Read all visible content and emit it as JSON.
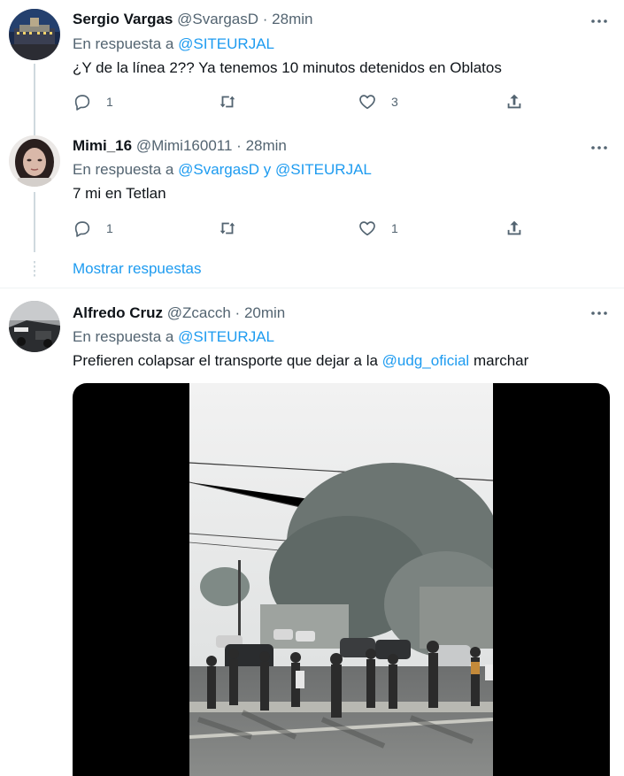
{
  "tweets": [
    {
      "name": "Sergio Vargas",
      "handle": "@SvargasD",
      "sep": "·",
      "time": "28min",
      "reply_prefix": "En respuesta a",
      "reply_to": [
        "@SITEURJAL"
      ],
      "text": "¿Y de la línea 2?? Ya tenemos 10 minutos detenidos en Oblatos",
      "replies": "1",
      "retweets": "",
      "likes": "3"
    },
    {
      "name": "Mimi_16",
      "handle": "@Mimi160011",
      "sep": "·",
      "time": "28min",
      "reply_prefix": "En respuesta a",
      "reply_to": [
        "@SvargasD",
        "@SITEURJAL"
      ],
      "reply_joiner": "y",
      "text": "7 mi en Tetlan",
      "replies": "1",
      "retweets": "",
      "likes": "1"
    },
    {
      "name": "Alfredo Cruz",
      "handle": "@Zcacch",
      "sep": "·",
      "time": "20min",
      "reply_prefix": "En respuesta a",
      "reply_to": [
        "@SITEURJAL"
      ],
      "text_before": "Prefieren colapsar el transporte que dejar a la",
      "text_mention": "@udg_oficial",
      "text_after": "marchar"
    }
  ],
  "show_replies": "Mostrar respuestas",
  "icons": {
    "more": "more-icon",
    "reply": "reply-icon",
    "retweet": "retweet-icon",
    "like": "like-icon",
    "share": "share-icon"
  },
  "colors": {
    "accent": "#1d9bf0",
    "secondary_text": "#536471",
    "primary_text": "#0f1419",
    "thread_line": "#cfd9de"
  }
}
